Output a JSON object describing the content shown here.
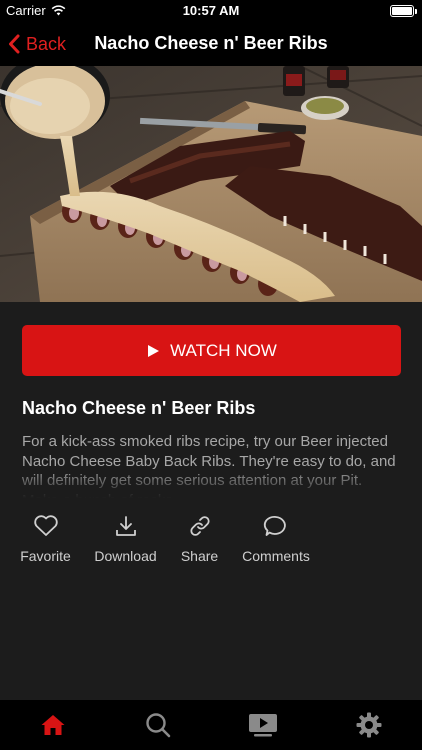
{
  "status_bar": {
    "carrier": "Carrier",
    "time": "10:57 AM",
    "battery_level": 1.0
  },
  "nav": {
    "back_label": "Back",
    "title": "Nacho Cheese n' Beer Ribs"
  },
  "hero": {
    "image_alt": "Nacho cheese sauce being poured over sliced smoked baby back ribs on a cutting board"
  },
  "watch_button": {
    "label": "WATCH NOW"
  },
  "recipe": {
    "title": "Nacho Cheese n' Beer Ribs",
    "description": "For a kick-ass smoked ribs recipe, try our Beer injected Nacho Cheese Baby Back Ribs. They're easy to do, and will definitely get some serious attention at your Pit. Make a bunch of racks"
  },
  "actions": [
    {
      "label": "Favorite",
      "icon": "heart-icon"
    },
    {
      "label": "Download",
      "icon": "download-icon"
    },
    {
      "label": "Share",
      "icon": "link-icon"
    },
    {
      "label": "Comments",
      "icon": "comment-icon"
    }
  ],
  "tabs": [
    {
      "icon": "home-icon",
      "active": true
    },
    {
      "icon": "search-icon",
      "active": false
    },
    {
      "icon": "video-icon",
      "active": false
    },
    {
      "icon": "gear-icon",
      "active": false
    }
  ],
  "colors": {
    "accent": "#d81414",
    "background": "#1c1c1c",
    "bar": "#000000",
    "inactive": "#8a8a8a"
  }
}
